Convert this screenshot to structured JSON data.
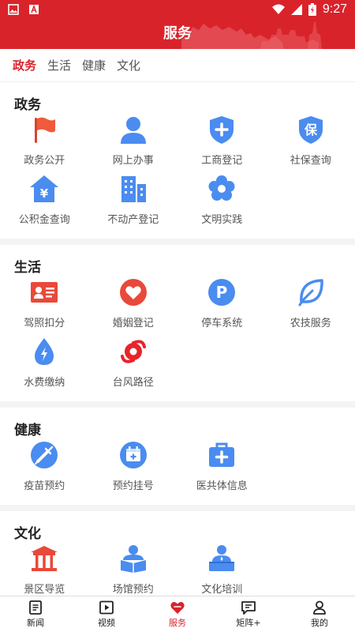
{
  "statusbar": {
    "time": "9:27"
  },
  "header": {
    "title": "服务"
  },
  "tabs": [
    {
      "label": "政务"
    },
    {
      "label": "生活"
    },
    {
      "label": "健康"
    },
    {
      "label": "文化"
    }
  ],
  "sections": [
    {
      "title": "政务",
      "items": [
        {
          "label": "政务公开",
          "icon": "flag-icon"
        },
        {
          "label": "网上办事",
          "icon": "person-icon"
        },
        {
          "label": "工商登记",
          "icon": "shield-plus-icon"
        },
        {
          "label": "社保查询",
          "icon": "shield-bao-icon"
        },
        {
          "label": "公积金查询",
          "icon": "house-yuan-icon"
        },
        {
          "label": "不动产登记",
          "icon": "buildings-icon"
        },
        {
          "label": "文明实践",
          "icon": "flower-icon"
        }
      ]
    },
    {
      "title": "生活",
      "items": [
        {
          "label": "驾照扣分",
          "icon": "id-card-icon"
        },
        {
          "label": "婚姻登记",
          "icon": "heart-icon"
        },
        {
          "label": "停车系统",
          "icon": "parking-icon"
        },
        {
          "label": "农技服务",
          "icon": "leaf-icon"
        },
        {
          "label": "水费缴纳",
          "icon": "water-drop-icon"
        },
        {
          "label": "台风路径",
          "icon": "typhoon-icon"
        }
      ]
    },
    {
      "title": "健康",
      "items": [
        {
          "label": "疫苗预约",
          "icon": "syringe-icon"
        },
        {
          "label": "预约挂号",
          "icon": "calendar-plus-icon"
        },
        {
          "label": "医共体信息",
          "icon": "medical-kit-icon"
        }
      ]
    },
    {
      "title": "文化",
      "items": [
        {
          "label": "景区导览",
          "icon": "pavilion-icon"
        },
        {
          "label": "场馆预约",
          "icon": "reader-icon"
        },
        {
          "label": "文化培训",
          "icon": "lecturer-icon"
        }
      ]
    }
  ],
  "bottomnav": [
    {
      "label": "新闻",
      "icon": "news-icon"
    },
    {
      "label": "视频",
      "icon": "video-icon"
    },
    {
      "label": "服务",
      "icon": "service-icon"
    },
    {
      "label": "矩阵+",
      "icon": "chat-matrix-icon"
    },
    {
      "label": "我的",
      "icon": "user-icon"
    }
  ],
  "colors": {
    "brand": "#d9232b",
    "icon_blue": "#4a8cf0",
    "icon_red": "#e8493a"
  }
}
